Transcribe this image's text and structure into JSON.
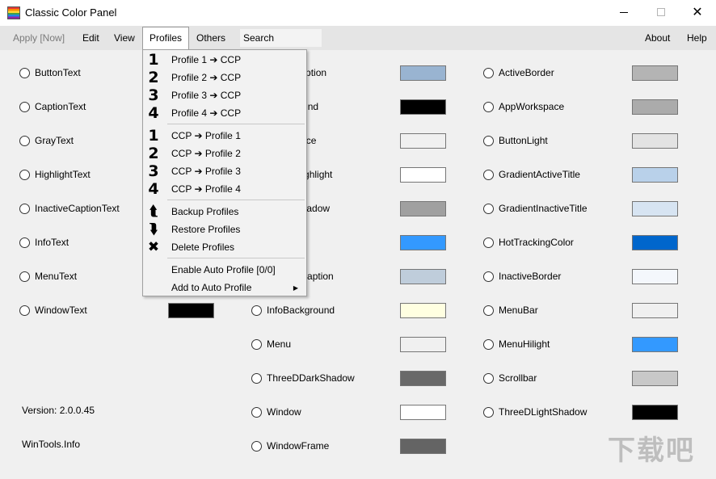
{
  "window": {
    "title": "Classic Color Panel"
  },
  "menubar": {
    "apply": "Apply [Now]",
    "edit": "Edit",
    "view": "View",
    "profiles": "Profiles",
    "others": "Others",
    "search_placeholder": "Search",
    "about": "About",
    "help": "Help"
  },
  "profiles_menu": {
    "items": [
      {
        "icon": "1",
        "label": "Profile 1 ➔ CCP"
      },
      {
        "icon": "2",
        "label": "Profile 2 ➔ CCP"
      },
      {
        "icon": "3",
        "label": "Profile 3 ➔ CCP"
      },
      {
        "icon": "4",
        "label": "Profile 4 ➔ CCP"
      },
      {
        "icon": "1",
        "label": "CCP ➔ Profile 1"
      },
      {
        "icon": "2",
        "label": "CCP ➔ Profile 2"
      },
      {
        "icon": "3",
        "label": "CCP ➔ Profile 3"
      },
      {
        "icon": "4",
        "label": "CCP ➔ Profile 4"
      },
      {
        "icon": "backup-arrow-icon",
        "label": "Backup Profiles"
      },
      {
        "icon": "restore-arrow-icon",
        "label": "Restore Profiles"
      },
      {
        "icon": "delete-x-icon",
        "label": "Delete Profiles"
      },
      {
        "label": "Enable Auto Profile [0/0]"
      },
      {
        "label": "Add to Auto Profile",
        "submenu": true
      }
    ]
  },
  "col1": [
    {
      "label": "ButtonText"
    },
    {
      "label": "CaptionText"
    },
    {
      "label": "GrayText"
    },
    {
      "label": "HighlightText"
    },
    {
      "label": "InactiveCaptionText"
    },
    {
      "label": "InfoText"
    },
    {
      "label": "MenuText"
    },
    {
      "label": "WindowText",
      "color": "#000000"
    }
  ],
  "col2": [
    {
      "label": "ActiveCaption",
      "color": "#99b4d1"
    },
    {
      "label": "Background",
      "color": "#000000"
    },
    {
      "label": "ButtonFace",
      "color": "#f0f0f0"
    },
    {
      "label": "ButtonHighlight",
      "color": "#ffffff"
    },
    {
      "label": "ButtonShadow",
      "color": "#a0a0a0"
    },
    {
      "label": "Highlight",
      "color": "#3399ff"
    },
    {
      "label": "InactiveCaption",
      "color": "#bfcddb"
    },
    {
      "label": "InfoBackground",
      "color": "#ffffe1"
    },
    {
      "label": "Menu",
      "color": "#f0f0f0"
    },
    {
      "label": "ThreeDDarkShadow",
      "color": "#696969"
    },
    {
      "label": "Window",
      "color": "#ffffff"
    },
    {
      "label": "WindowFrame",
      "color": "#646464"
    }
  ],
  "col3": [
    {
      "label": "ActiveBorder",
      "color": "#b4b4b4"
    },
    {
      "label": "AppWorkspace",
      "color": "#ababab"
    },
    {
      "label": "ButtonLight",
      "color": "#e3e3e3"
    },
    {
      "label": "GradientActiveTitle",
      "color": "#b9d1ea"
    },
    {
      "label": "GradientInactiveTitle",
      "color": "#d7e4f2"
    },
    {
      "label": "HotTrackingColor",
      "color": "#0066cc"
    },
    {
      "label": "InactiveBorder",
      "color": "#f4f7fc"
    },
    {
      "label": "MenuBar",
      "color": "#f0f0f0"
    },
    {
      "label": "MenuHilight",
      "color": "#3399ff"
    },
    {
      "label": "Scrollbar",
      "color": "#c8c8c8"
    },
    {
      "label": "ThreeDLightShadow",
      "color": "#000000"
    }
  ],
  "footer": {
    "version": "Version: 2.0.0.45",
    "site": "WinTools.Info"
  }
}
